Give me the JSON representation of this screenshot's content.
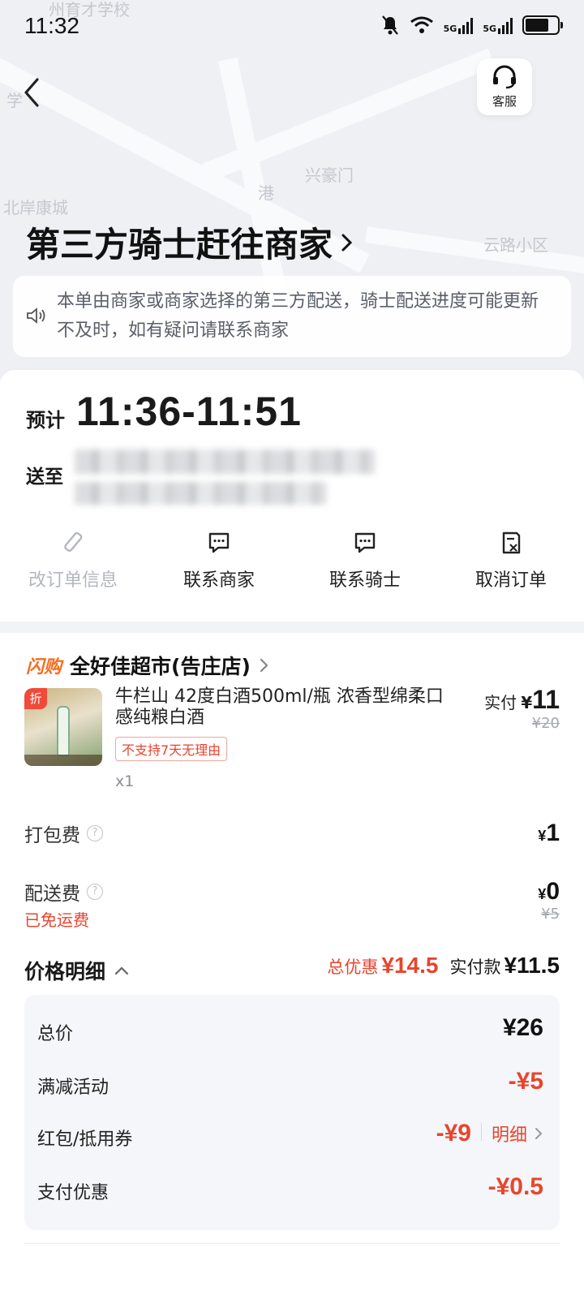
{
  "status_bar": {
    "time": "11:32",
    "network_label_1": "5G",
    "network_label_2": "5G"
  },
  "map": {
    "labels": [
      "州育才学校",
      "学",
      "兴豪门",
      "北岸康城",
      "港",
      "云路小区"
    ]
  },
  "header": {
    "service_label": "客服"
  },
  "headline": {
    "title": "第三方骑士赶往商家"
  },
  "notice": {
    "text": "本单由商家或商家选择的第三方配送，骑士配送进度可能更新不及时，如有疑问请联系商家"
  },
  "eta": {
    "prefix": "预计",
    "range": "11:36-11:51",
    "deliver_to_label": "送至"
  },
  "actions": [
    {
      "label": "改订单信息",
      "icon": "pencil-icon",
      "enabled": false
    },
    {
      "label": "联系商家",
      "icon": "chat-icon",
      "enabled": true
    },
    {
      "label": "联系骑士",
      "icon": "chat-icon",
      "enabled": true
    },
    {
      "label": "取消订单",
      "icon": "cancel-order-icon",
      "enabled": true
    }
  ],
  "store": {
    "badge": "闪购",
    "name": "全好佳超市(告庄店)"
  },
  "product": {
    "discount_tag": "折",
    "name": "牛栏山 42度白酒500ml/瓶 浓香型绵柔口感纯粮白酒",
    "no_return_tag": "不支持7天无理由",
    "quantity": "x1",
    "paid_label": "实付",
    "currency": "¥",
    "paid_value": "11",
    "original_price": "¥20"
  },
  "fees": {
    "packing_label": "打包费",
    "packing_value": "1",
    "delivery_label": "配送费",
    "delivery_value": "0",
    "delivery_original": "¥5",
    "free_shipping_note": "已免运费"
  },
  "price_detail": {
    "title": "价格明细",
    "total_discount_label": "总优惠",
    "total_discount_value": "¥14.5",
    "actual_payment_label": "实付款",
    "actual_payment_value": "¥11.5",
    "rows": [
      {
        "label": "总价",
        "value": "¥26"
      },
      {
        "label": "满减活动",
        "value": "-¥5"
      },
      {
        "label": "红包/抵用券",
        "value": "-¥9",
        "link": "明细"
      },
      {
        "label": "支付优惠",
        "value": "-¥0.5"
      }
    ]
  },
  "colors": {
    "accent_red": "#e8452e",
    "flash_orange": "#f56c1e",
    "text_main": "#1a1a1a"
  }
}
